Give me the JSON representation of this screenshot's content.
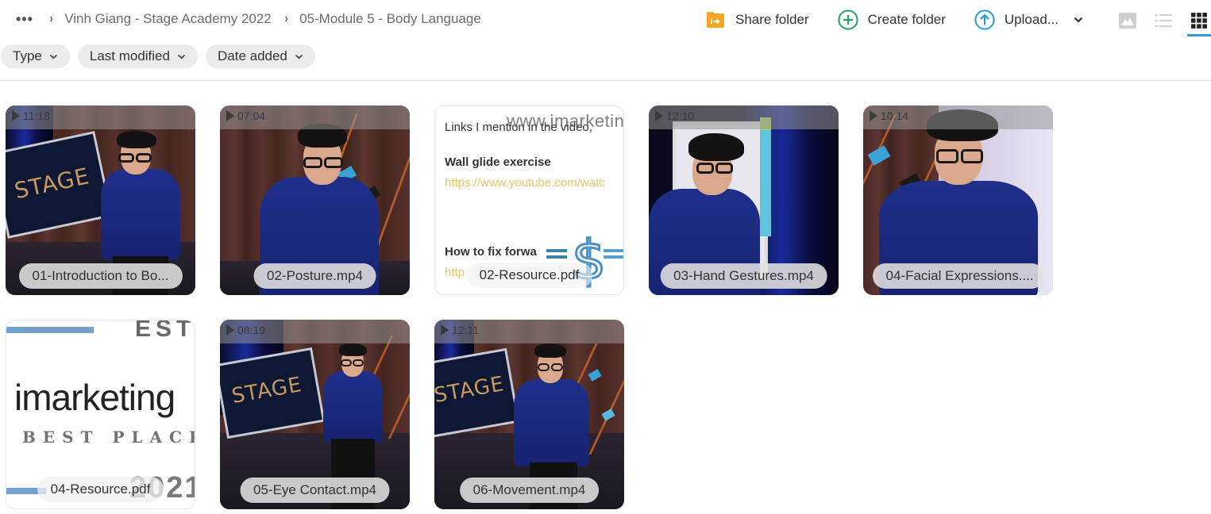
{
  "breadcrumb": {
    "more_label": "•••",
    "separator": "›",
    "items": [
      "Vinh Giang - Stage Academy 2022",
      "05-Module 5 - Body Language"
    ]
  },
  "toolbar": {
    "share_label": "Share folder",
    "create_label": "Create folder",
    "upload_label": "Upload...",
    "view_modes": [
      {
        "name": "thumbnail-view",
        "active": false
      },
      {
        "name": "list-view",
        "active": false
      },
      {
        "name": "grid-view",
        "active": true
      }
    ],
    "colors": {
      "share": "#f5a623",
      "create": "#27a361",
      "upload": "#2f9bd6",
      "active_underline": "#2f9bd6"
    }
  },
  "filters": [
    {
      "label": "Type"
    },
    {
      "label": "Last modified"
    },
    {
      "label": "Date added"
    }
  ],
  "files": [
    {
      "name": "01-Introduction to Bo...",
      "type": "video",
      "duration": "11:18"
    },
    {
      "name": "02-Posture.mp4",
      "type": "video",
      "duration": "07:04"
    },
    {
      "name": "02-Resource.pdf",
      "type": "pdf",
      "preview": {
        "line1": "Links I mention in the video,",
        "watermark": "www.imarketin",
        "heading1": "Wall glide exercise",
        "link1": "https://www.youtube.com/watc",
        "heading2": "How to fix forwa",
        "link2": "http"
      }
    },
    {
      "name": "03-Hand Gestures.mp4",
      "type": "video",
      "duration": "12:10"
    },
    {
      "name": "04-Facial Expressions....",
      "type": "video",
      "duration": "10:14"
    },
    {
      "name": "04-Resource.pdf",
      "type": "pdf",
      "preview": {
        "top": "EST.",
        "brand": "imarketing",
        "tagline": "BEST PLACE T",
        "year": "2021"
      }
    },
    {
      "name": "05-Eye Contact.mp4",
      "type": "video",
      "duration": "08:19"
    },
    {
      "name": "06-Movement.mp4",
      "type": "video",
      "duration": "12:11"
    }
  ],
  "board_text": "STAGE"
}
